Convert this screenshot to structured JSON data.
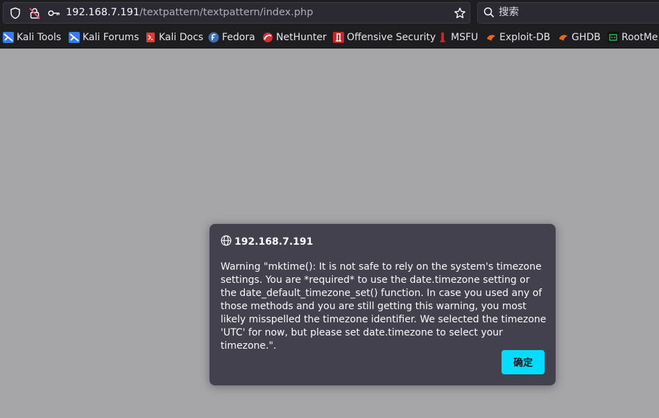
{
  "url_bar": {
    "host": "192.168.7.191",
    "path": "/textpattern/textpattern/index.php"
  },
  "search_bar": {
    "placeholder": "搜索"
  },
  "bookmarks": [
    {
      "label": "Kali Tools",
      "icon": "kali-tools-icon"
    },
    {
      "label": "Kali Forums",
      "icon": "kali-forums-icon"
    },
    {
      "label": "Kali Docs",
      "icon": "kali-docs-icon"
    },
    {
      "label": "Fedora",
      "icon": "fedora-icon"
    },
    {
      "label": "NetHunter",
      "icon": "nethunter-icon"
    },
    {
      "label": "Offensive Security",
      "icon": "offensive-security-icon"
    },
    {
      "label": "MSFU",
      "icon": "msfu-icon"
    },
    {
      "label": "Exploit-DB",
      "icon": "exploit-db-icon"
    },
    {
      "label": "GHDB",
      "icon": "ghdb-icon"
    },
    {
      "label": "RootMe",
      "icon": "rootme-icon"
    }
  ],
  "dialog": {
    "title": "192.168.7.191",
    "message": "Warning \"mktime(): It is not safe to rely on the system's timezone settings. You are *required* to use the date.timezone setting or the date_default_timezone_set() function. In case you used any of those methods and you are still getting this warning, you most likely misspelled the timezone identifier. We selected the timezone 'UTC' for now, but please set date.timezone to select your timezone.\".",
    "ok_label": "确定"
  },
  "colors": {
    "page_background": "#a6a6a8",
    "toolbar": "#1e1e21",
    "dialog": "#42414d",
    "accent_button": "#00ddff"
  }
}
